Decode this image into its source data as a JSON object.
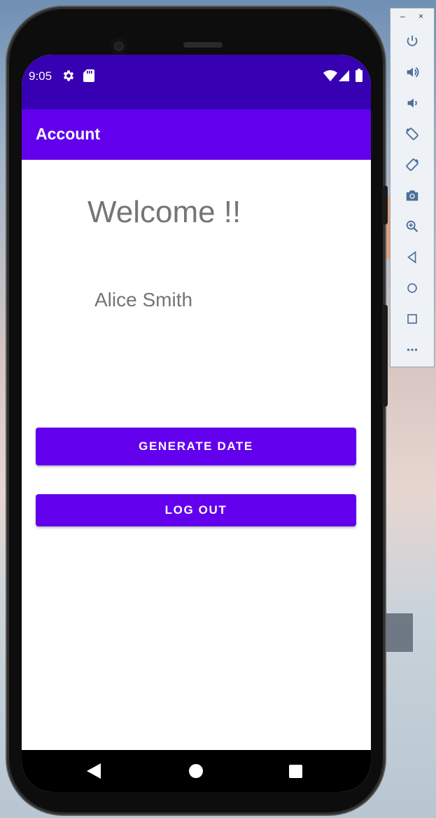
{
  "status_bar": {
    "time": "9:05"
  },
  "app_bar": {
    "title": "Account"
  },
  "main": {
    "welcome_text": "Welcome !!",
    "user_name": "Alice Smith"
  },
  "buttons": {
    "generate_date": "GENERATE DATE",
    "log_out": "LOG OUT"
  },
  "emulator_panel": {
    "minimize": "–",
    "close": "×",
    "icons": [
      "power-icon",
      "volume-up-icon",
      "volume-down-icon",
      "rotate-left-icon",
      "rotate-right-icon",
      "camera-icon",
      "zoom-icon",
      "back-icon",
      "home-icon",
      "overview-icon",
      "more-icon"
    ]
  },
  "colors": {
    "status_bar": "#3700B3",
    "primary": "#6200EE",
    "text_gray": "#757575"
  }
}
